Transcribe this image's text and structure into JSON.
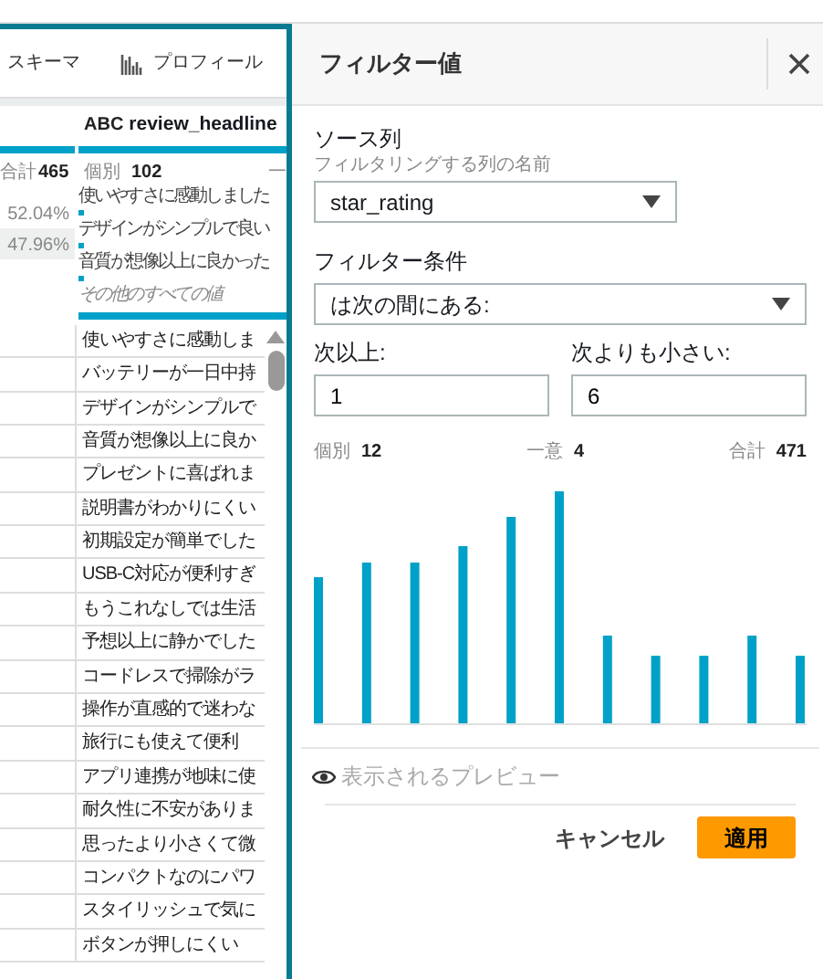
{
  "left_panel": {
    "toolbar_tabs": [
      {
        "label": "スキーマ",
        "kind": "schema"
      },
      {
        "label": "プロフィール",
        "kind": "profile"
      }
    ],
    "column_1": {
      "total_label": "合計",
      "total": "465",
      "values": [
        {
          "percent": "52.04%",
          "highlighted": false
        },
        {
          "percent": "47.96%",
          "highlighted": true
        }
      ]
    },
    "review_column": {
      "type_tag": "ABC",
      "name": "review_headline",
      "distinct_label": "個別",
      "distinct": "102",
      "unique_label": "一",
      "top_values": [
        {
          "text": "使いやすさに感動しました"
        },
        {
          "text": "デザインがシンプルで良い"
        },
        {
          "text": "音質が想像以上に良かった"
        }
      ],
      "other": "その他のすべての値"
    },
    "rows": [
      "使いやすさに感動しま",
      "バッテリーが一日中持",
      "デザインがシンプルで",
      "音質が想像以上に良か",
      "プレゼントに喜ばれま",
      "説明書がわかりにくい",
      "初期設定が簡単でした",
      "USB-C対応が便利すぎ",
      "もうこれなしでは生活",
      "予想以上に静かでした",
      "コードレスで掃除がラ",
      "操作が直感的で迷わな",
      "旅行にも使えて便利",
      "アプリ連携が地味に使",
      "耐久性に不安がありま",
      "思ったより小さくて微",
      "コンパクトなのにパワ",
      "スタイリッシュで気に",
      "ボタンが押しにくい"
    ]
  },
  "filter_panel": {
    "title": "フィルター値",
    "source_label": "ソース列",
    "source_hint": "フィルタリングする列の名前",
    "source_value": "star_rating",
    "condition_label": "フィルター条件",
    "condition_value": "は次の間にある:",
    "min_label": "次以上:",
    "min_value": "1",
    "max_label": "次よりも小さい:",
    "max_value": "6",
    "stats": [
      {
        "label": "個別",
        "value": "12"
      },
      {
        "label": "一意",
        "value": "4"
      },
      {
        "label": "合計",
        "value": "471"
      }
    ],
    "preview_label": "表示されるプレビュー",
    "cancel_button": "キャンセル",
    "apply_button": "適用"
  }
}
